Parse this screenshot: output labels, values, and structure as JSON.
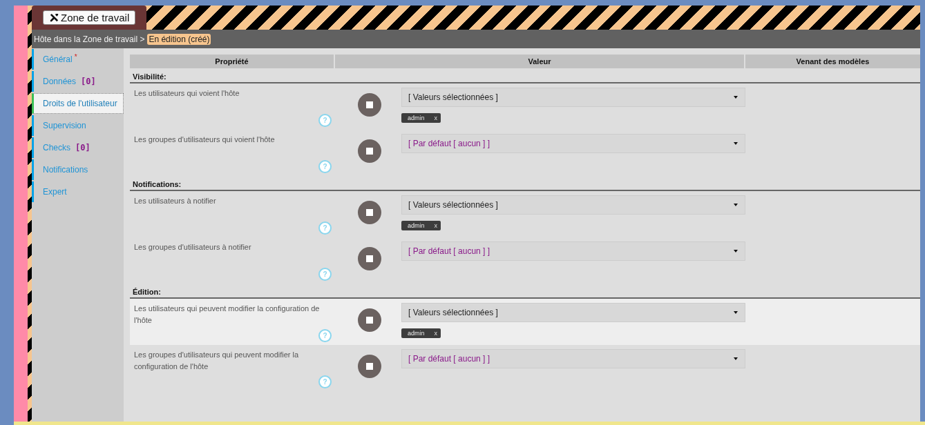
{
  "header": {
    "workspace_button": "Zone de travail",
    "breadcrumb": "Hôte dans la Zone de travail >",
    "status_badge": "En édition (créé)"
  },
  "sidebar": {
    "items": [
      {
        "label": "Général",
        "required": "*",
        "selected": false
      },
      {
        "label": "Données",
        "count": "[0]",
        "selected": false
      },
      {
        "label": "Droits de l'utilisateur",
        "selected": true
      },
      {
        "label": "Supervision",
        "selected": false
      },
      {
        "label": "Checks",
        "count": "[0]",
        "selected": false
      },
      {
        "label": "Notifications",
        "selected": false
      },
      {
        "label": "Expert",
        "selected": false
      }
    ]
  },
  "table": {
    "columns": [
      "Propriété",
      "Valeur",
      "Venant des modèles"
    ],
    "sections": [
      {
        "title": "Visibilité:",
        "rows": [
          {
            "label": "Les utilisateurs qui voient l'hôte",
            "help": "?",
            "highlighted": false,
            "value": {
              "kind": "selected",
              "text": "[ Valeurs sélectionnées ]"
            },
            "tags": [
              {
                "text": "admin",
                "remove": "x"
              }
            ]
          },
          {
            "label": "Les groupes d'utilisateurs qui voient l'hôte",
            "help": "?",
            "highlighted": false,
            "value": {
              "kind": "default",
              "text": "[ Par défaut [ aucun ] ]"
            }
          }
        ]
      },
      {
        "title": "Notifications:",
        "rows": [
          {
            "label": "Les utilisateurs à notifier",
            "help": "?",
            "highlighted": false,
            "value": {
              "kind": "selected",
              "text": "[ Valeurs sélectionnées ]"
            },
            "tags": [
              {
                "text": "admin",
                "remove": "x"
              }
            ]
          },
          {
            "label": "Les groupes d'utilisateurs à notifier",
            "help": "?",
            "highlighted": false,
            "value": {
              "kind": "default",
              "text": "[ Par défaut [ aucun ] ]"
            }
          }
        ]
      },
      {
        "title": "Édition:",
        "rows": [
          {
            "label": "Les utilisateurs qui peuvent modifier la configuration de l'hôte",
            "help": "?",
            "highlighted": true,
            "value": {
              "kind": "selected",
              "text": "[ Valeurs sélectionnées ]"
            },
            "tags": [
              {
                "text": "admin",
                "remove": "x"
              }
            ]
          },
          {
            "label": "Les groupes d'utilisateurs qui peuvent modifier la configuration de l'hôte",
            "help": "?",
            "highlighted": false,
            "value": {
              "kind": "default",
              "text": "[ Par défaut [ aucun ] ]"
            }
          }
        ]
      }
    ]
  }
}
